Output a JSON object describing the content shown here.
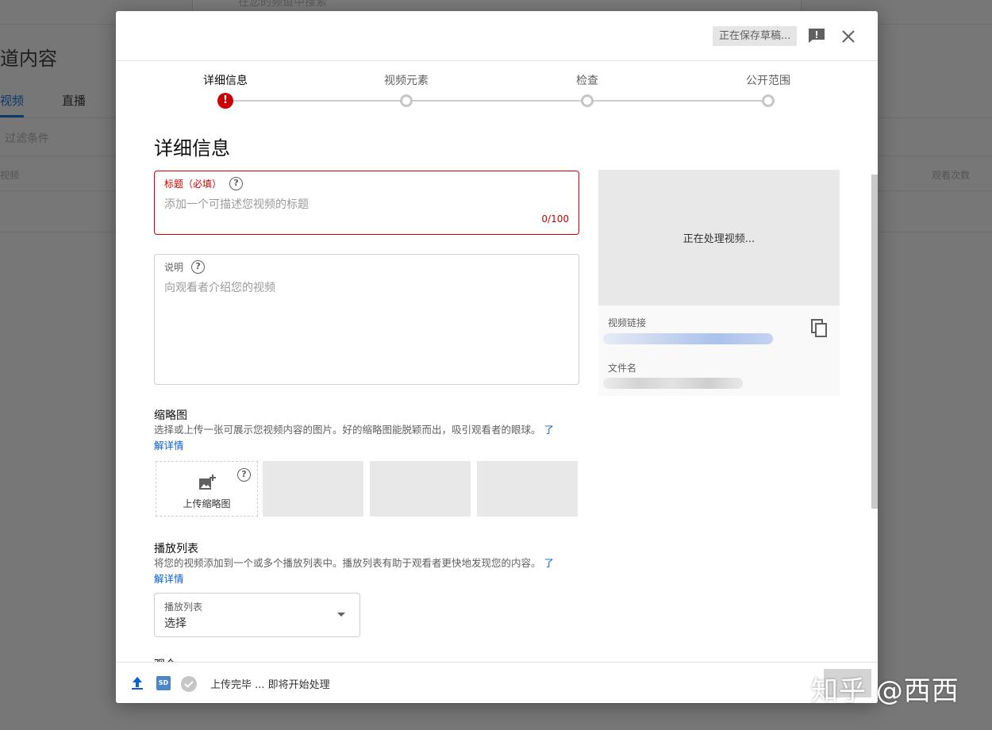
{
  "background": {
    "search_placeholder": "在您的频道中搜索",
    "page_title": "道内容",
    "tabs": [
      "视频",
      "直播"
    ],
    "filter_placeholder": "过滤条件",
    "col_video": "视频",
    "col_views": "观看次数"
  },
  "header": {
    "saving_status": "正在保存草稿...",
    "feedback_icon": "feedback-icon",
    "close_icon": "close-icon"
  },
  "steps": [
    {
      "label": "详细信息",
      "state": "error"
    },
    {
      "label": "视频元素",
      "state": "pending"
    },
    {
      "label": "检查",
      "state": "pending"
    },
    {
      "label": "公开范围",
      "state": "pending"
    }
  ],
  "details": {
    "heading": "详细信息",
    "title_field": {
      "label": "标题（必填）",
      "placeholder": "添加一个可描述您视频的标题",
      "counter": "0/100"
    },
    "description_field": {
      "label": "说明",
      "placeholder": "向观看者介绍您的视频"
    }
  },
  "preview": {
    "processing": "正在处理视频...",
    "link_label": "视频链接",
    "filename_label": "文件名"
  },
  "thumbnail": {
    "heading": "缩略图",
    "desc": "选择或上传一张可展示您视频内容的图片。好的缩略图能脱颖而出，吸引观看者的眼球。",
    "learn_more_1": "了",
    "learn_more_2": "解详情",
    "upload_label": "上传缩略图"
  },
  "playlist": {
    "heading": "播放列表",
    "desc": "将您的视频添加到一个或多个播放列表中。播放列表有助于观看者更快地发现您的内容。",
    "learn_more_1": "了",
    "learn_more_2": "解详情",
    "select_label": "播放列表",
    "select_value": "选择"
  },
  "cutoff_heading": "观众",
  "footer": {
    "status": "上传完毕 ... 即将开始处理",
    "badge": "SD"
  },
  "watermark": "知乎 @西西"
}
